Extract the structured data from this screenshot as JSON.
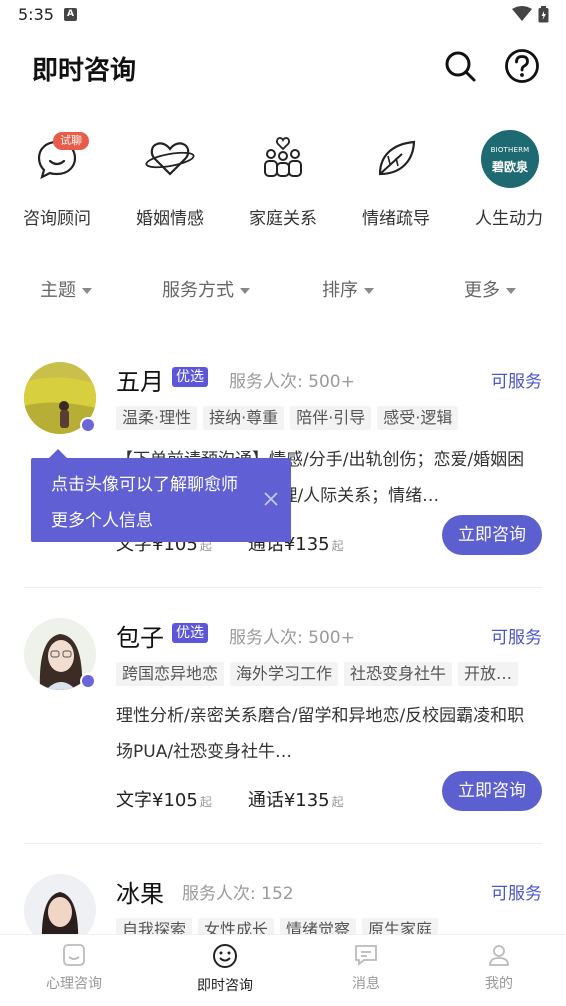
{
  "status": {
    "time": "5:35",
    "notif": "A"
  },
  "header": {
    "title": "即时咨询"
  },
  "categories": [
    {
      "label": "咨询顾问",
      "badge": "试聊"
    },
    {
      "label": "婚姻情感"
    },
    {
      "label": "家庭关系"
    },
    {
      "label": "情绪疏导"
    },
    {
      "label": "人生动力",
      "logo_en": "BIOTHERM",
      "logo_cn": "碧欧泉"
    }
  ],
  "filters": [
    "主题",
    "服务方式",
    "排序",
    "更多"
  ],
  "counselors": [
    {
      "name": "五月",
      "badge": "优选",
      "served": "服务人次: 500+",
      "status": "可服务",
      "tags": [
        "温柔·理性",
        "接纳·尊重",
        "陪伴·引导",
        "感受·逻辑"
      ],
      "desc": "【下单前请预沟通】情感/分手/出轨创伤；恋爱/婚姻困扰；个体/职场成长/管理/人际关系；情绪…",
      "text_price": "文字¥105",
      "call_price": "通话¥135",
      "qi": "起",
      "button": "立即咨询"
    },
    {
      "name": "包子",
      "badge": "优选",
      "served": "服务人次: 500+",
      "status": "可服务",
      "tags": [
        "跨国恋异地恋",
        "海外学习工作",
        "社恐变身社牛",
        "开放…"
      ],
      "desc": "理性分析/亲密关系磨合/留学和异地恋/反校园霸凌和职场PUA/社恐变身社牛…",
      "text_price": "文字¥105",
      "call_price": "通话¥135",
      "qi": "起",
      "button": "立即咨询"
    },
    {
      "name": "冰果",
      "served": "服务人次: 152",
      "status": "可服务",
      "tags": [
        "自我探索",
        "女性成长",
        "情绪觉察",
        "原生家庭"
      ]
    }
  ],
  "tooltip": {
    "line1": "点击头像可以了解聊愈师",
    "line2": "更多个人信息"
  },
  "tabbar": [
    {
      "label": "心理咨询"
    },
    {
      "label": "即时咨询",
      "active": true
    },
    {
      "label": "消息"
    },
    {
      "label": "我的"
    }
  ],
  "colors": {
    "accent": "#5b5fcf",
    "badge": "#5b57d6",
    "available": "#4b56c8",
    "trial": "#e85d4a"
  }
}
